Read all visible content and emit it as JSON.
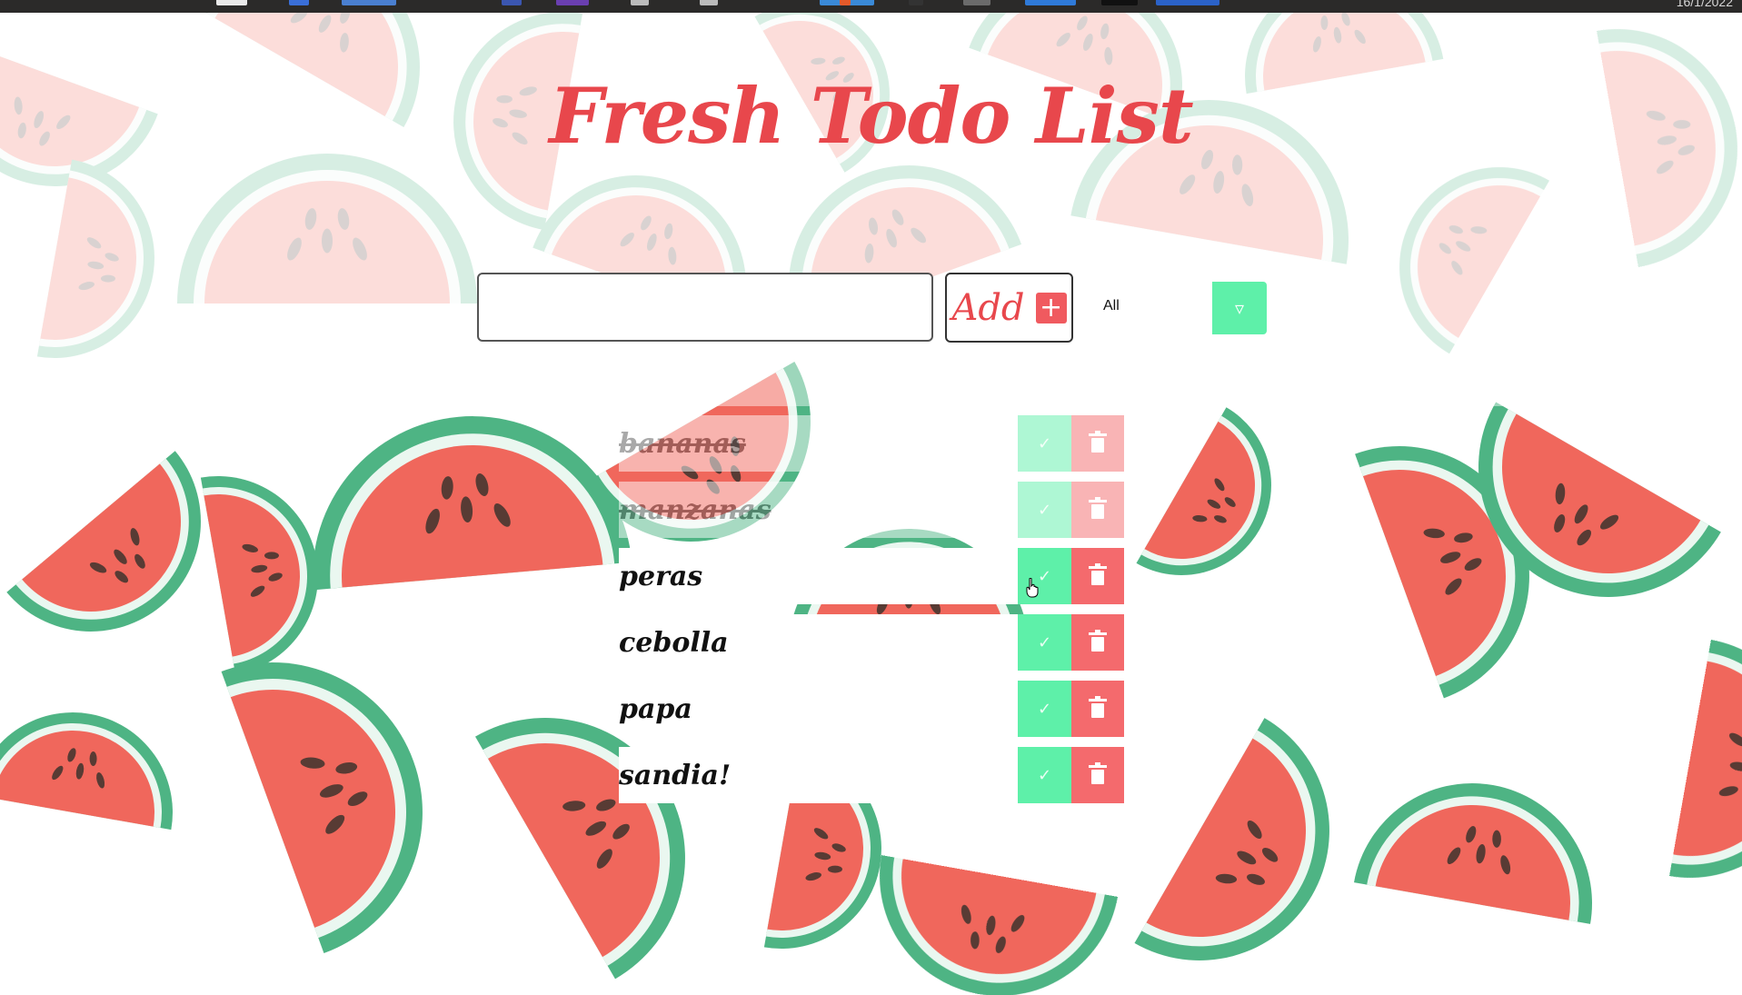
{
  "taskbar": {
    "clock": "16/1/2022",
    "icon_colors": [
      "#e9e9e9",
      "#3a6fd8",
      "#4a7fd0",
      "#3b56b0",
      "#6a3fb0",
      "#bbbbbb",
      "#bbbbbb",
      "#e45a2a",
      "#333333",
      "#6b6b6b",
      "#2f7ad9",
      "#111111",
      "#2b62c8"
    ]
  },
  "app": {
    "title": "Fresh Todo List",
    "accent_color": "#e8474c",
    "check_color": "#5ef0a9",
    "trash_color": "#f46a6d"
  },
  "form": {
    "input_value": "",
    "add_label": "Add",
    "add_icon": "plus-icon",
    "filter": {
      "selected": "All",
      "arrow_icon": "triangle-down-icon"
    }
  },
  "todos": [
    {
      "text": "bananas",
      "completed": true
    },
    {
      "text": "manzanas",
      "completed": true
    },
    {
      "text": "peras",
      "completed": false
    },
    {
      "text": "cebolla",
      "completed": false
    },
    {
      "text": "papa",
      "completed": false
    },
    {
      "text": "sandia!",
      "completed": false
    }
  ],
  "icons": {
    "check": "check-icon",
    "trash": "trash-icon"
  }
}
